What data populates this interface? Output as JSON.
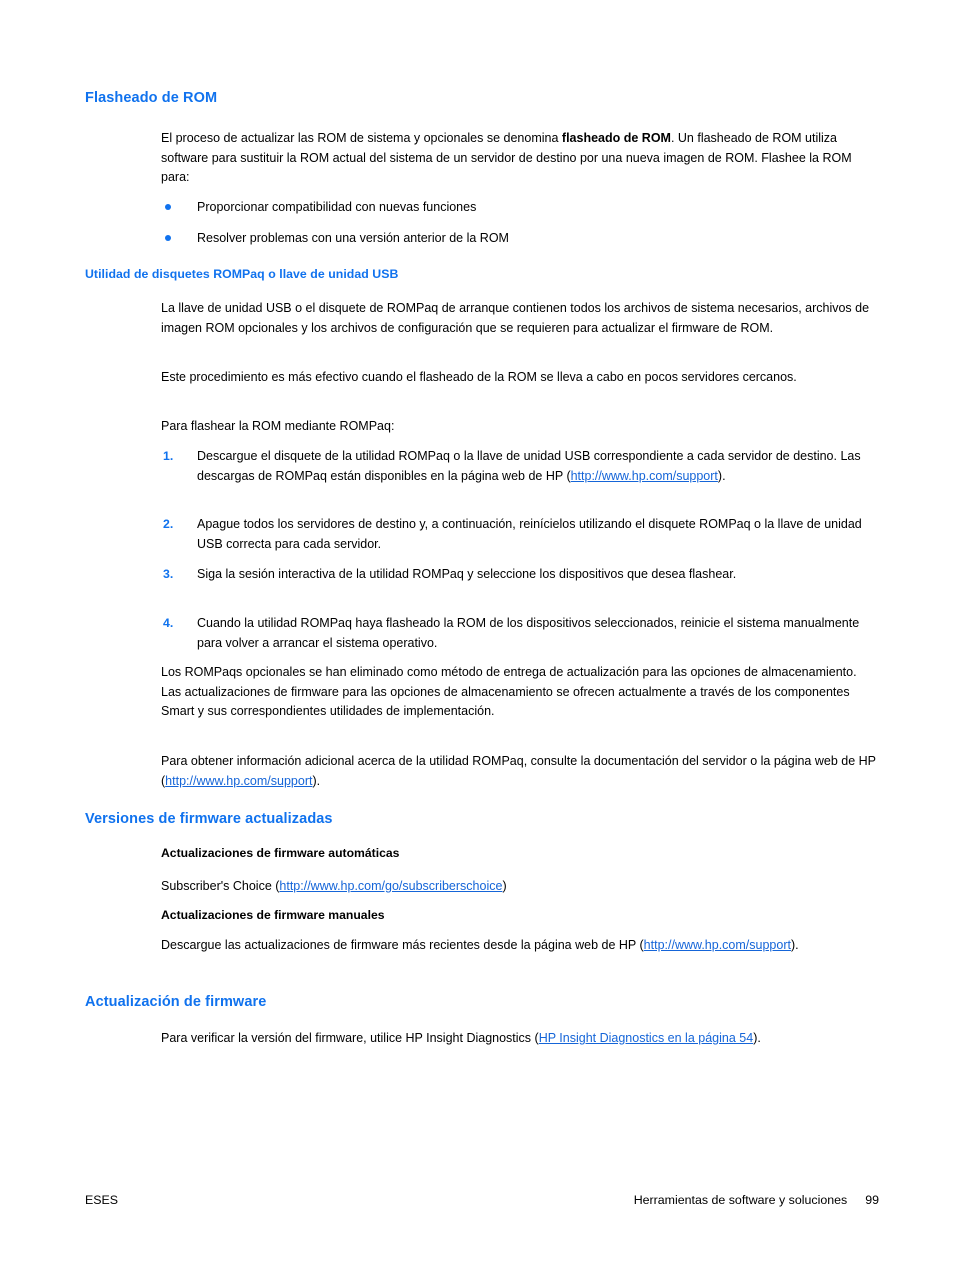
{
  "document": {
    "language_code": "ESES",
    "section_title": "Herramientas de software y soluciones",
    "page_number": "99"
  },
  "sections": [
    {
      "heading": "Flasheado de ROM",
      "intro_before_bold": "El proceso de actualizar las ROM de sistema y opcionales se denomina ",
      "intro_bold": "flasheado de ROM",
      "intro_after_bold": ". Un flasheado de ROM utiliza software para sustituir la ROM actual del sistema de un servidor de destino por una nueva imagen de ROM. Flashee la ROM para:",
      "bullets": [
        "Proporcionar compatibilidad con nuevas funciones",
        "Resolver problemas con una versión anterior de la ROM"
      ]
    }
  ],
  "subsection_rompaq": {
    "heading": "Utilidad de disquetes ROMPaq o llave de unidad USB",
    "paragraph_1": "La llave de unidad USB o el disquete de ROMPaq de arranque contienen todos los archivos de sistema necesarios, archivos de imagen ROM opcionales y los archivos de configuración que se requieren para actualizar el firmware de ROM.",
    "paragraph_2": "Este procedimiento es más efectivo cuando el flasheado de la ROM se lleva a cabo en pocos servidores cercanos.",
    "paragraph_3": "Para flashear la ROM mediante ROMPaq:",
    "steps": [
      {
        "number": "1.",
        "text_before_link": "Descargue el disquete de la utilidad ROMPaq o la llave de unidad USB correspondiente a cada servidor de destino. Las descargas de ROMPaq están disponibles en la página web de HP (",
        "link_text": "http://www.hp.com/support",
        "text_after_link": ")."
      },
      {
        "number": "2.",
        "text_before_link": "Apague todos los servidores de destino y, a continuación, reinícielos utilizando el disquete ROMPaq o la llave de unidad USB correcta para cada servidor.",
        "link_text": "",
        "text_after_link": ""
      },
      {
        "number": "3.",
        "text_before_link": "Siga la sesión interactiva de la utilidad ROMPaq y seleccione los dispositivos que desea flashear.",
        "link_text": "",
        "text_after_link": ""
      },
      {
        "number": "4.",
        "text_before_link": "Cuando la utilidad ROMPaq haya flasheado la ROM de los dispositivos seleccionados, reinicie el sistema manualmente para volver a arrancar el sistema operativo.",
        "link_text": "",
        "text_after_link": ""
      }
    ],
    "paragraph_4": "Los ROMPaqs opcionales se han eliminado como método de entrega de actualización para las opciones de almacenamiento. Las actualizaciones de firmware para las opciones de almacenamiento se ofrecen actualmente a través de los componentes Smart y sus correspondientes utilidades de implementación.",
    "paragraph_5_before_link": "Para obtener información adicional acerca de la utilidad ROMPaq, consulte la documentación del servidor o la página web de HP (",
    "paragraph_5_link": "http://www.hp.com/support",
    "paragraph_5_after_link": ")."
  },
  "section_versiones": {
    "heading": "Versiones de firmware actualizadas",
    "sub_automatic": {
      "heading": "Actualizaciones de firmware automáticas",
      "text_before_link": "Subscriber's Choice (",
      "link_text": "http://www.hp.com/go/subscriberschoice",
      "text_after_link": ")"
    },
    "sub_manual": {
      "heading": "Actualizaciones de firmware manuales",
      "text_before_link": "Descargue las actualizaciones de firmware más recientes desde la página web de HP (",
      "link_text": "http://www.hp.com/support",
      "text_after_link": ")."
    }
  },
  "section_actualizacion": {
    "heading": "Actualización de firmware",
    "text_before_link": "Para verificar la versión del firmware, utilice HP Insight Diagnostics (",
    "link_text": "HP Insight Diagnostics en la página 54",
    "text_after_link": ")."
  },
  "colors": {
    "heading_blue": "#1072ee",
    "link_blue": "#1565d8",
    "body_black": "#000000"
  }
}
